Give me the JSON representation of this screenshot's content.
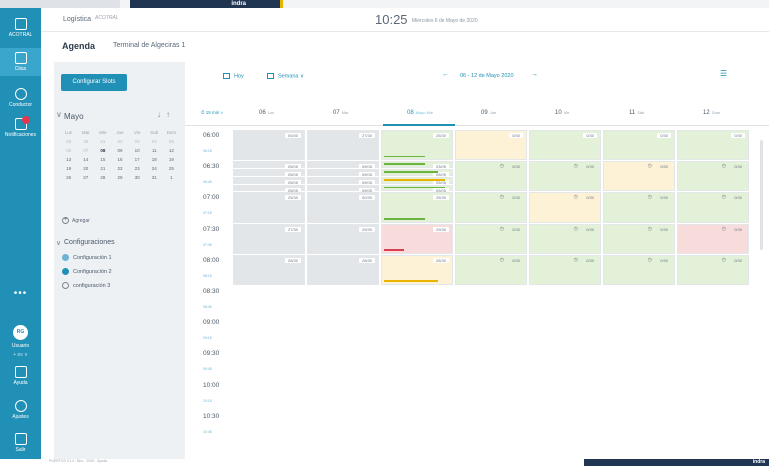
{
  "top_strip": {
    "brand": "indra"
  },
  "sidebar": {
    "items": [
      {
        "label": "ACOTRAL",
        "icon": "building-icon"
      },
      {
        "label": "Citas",
        "icon": "calendar-icon"
      },
      {
        "label": "Conductor",
        "icon": "driver-icon"
      },
      {
        "label": "Notificaciones",
        "icon": "bell-icon"
      }
    ],
    "more": "•••",
    "user": {
      "initials": "RG",
      "label": "Usuario",
      "sub": "+ es ∨"
    },
    "bottom": [
      {
        "label": "Ayuda",
        "icon": "help-icon"
      },
      {
        "label": "Ajustes",
        "icon": "gear-icon"
      },
      {
        "label": "Salir",
        "icon": "logout-icon"
      }
    ]
  },
  "header": {
    "app_name": "Logística",
    "logo_text": "ACOTRAL",
    "time": "10:25",
    "date": "Miércoles 6 de Mayo de 2020"
  },
  "page": {
    "title": "Agenda",
    "subtitle": "Terminal de Algeciras 1"
  },
  "left_panel": {
    "configure_button": "Configurar Slots",
    "month": "Mayo",
    "weekdays": [
      "Lun",
      "Mar",
      "Mie",
      "Jue",
      "Vie",
      "Sab",
      "Dom"
    ],
    "weeks": [
      [
        "29",
        "30",
        "01",
        "02",
        "03",
        "04",
        "05"
      ],
      [
        "06",
        "07",
        "08",
        "09",
        "10",
        "11",
        "12"
      ],
      [
        "13",
        "14",
        "15",
        "16",
        "17",
        "18",
        "19"
      ],
      [
        "19",
        "20",
        "21",
        "22",
        "23",
        "24",
        "25"
      ],
      [
        "26",
        "27",
        "28",
        "29",
        "30",
        "31",
        "1"
      ]
    ],
    "add_label": "Agregar",
    "configs_title": "Configuraciones",
    "configs": [
      "Configuración 1",
      "Configuración 2",
      "configuración 3"
    ]
  },
  "toolbar": {
    "today": "Hoy",
    "view": "Semana",
    "range": "06 - 12 de Mayo 2020",
    "prev": "←",
    "next": "→"
  },
  "interval": "15 min",
  "days": [
    {
      "num": "06",
      "name": "Lun"
    },
    {
      "num": "07",
      "name": "Mar"
    },
    {
      "num": "08",
      "name": "Mayo Mie"
    },
    {
      "num": "09",
      "name": "Jue"
    },
    {
      "num": "10",
      "name": "Vie"
    },
    {
      "num": "11",
      "name": "Sáb"
    },
    {
      "num": "12",
      "name": "Dom"
    }
  ],
  "times": [
    {
      "t": "06:00",
      "sub": "06:15"
    },
    {
      "t": "06:30",
      "sub": "06:45"
    },
    {
      "t": "07:00",
      "sub": "07:15"
    },
    {
      "t": "07:30",
      "sub": "07:45"
    },
    {
      "t": "08:00",
      "sub": "08:15"
    },
    {
      "t": "08:30",
      "sub": "08:45"
    },
    {
      "t": "09:00",
      "sub": "09:15"
    },
    {
      "t": "09:30",
      "sub": "09:45"
    },
    {
      "t": "10:00",
      "sub": "10:15"
    },
    {
      "t": "10:30",
      "sub": "10:45"
    }
  ],
  "colors": {
    "grey": "#e3e6e9",
    "green": "#e3f1d8",
    "yellow": "#fdf1d6",
    "red": "#f8dcdc",
    "green_bar": "#6db33f",
    "yellow_bar": "#e8b400",
    "red_bar": "#d9414f"
  },
  "slots": [
    {
      "day": 0,
      "row": 0,
      "span": 4,
      "color": "grey",
      "count": "00/30"
    },
    {
      "day": 1,
      "row": 0,
      "span": 4,
      "color": "grey",
      "count": "27/30"
    },
    {
      "day": 2,
      "row": 0,
      "span": 4,
      "color": "green",
      "count": "25/30",
      "bar": "green",
      "barw": 0.6
    },
    {
      "day": 3,
      "row": 0,
      "span": 4,
      "color": "yellow",
      "count": "0/30"
    },
    {
      "day": 4,
      "row": 0,
      "span": 4,
      "color": "green",
      "count": "0/30"
    },
    {
      "day": 5,
      "row": 0,
      "span": 4,
      "color": "green",
      "count": "0/30"
    },
    {
      "day": 6,
      "row": 0,
      "span": 4,
      "color": "green",
      "count": "0/30"
    },
    {
      "day": 0,
      "row": 4,
      "span": 1,
      "color": "grey",
      "count": "05/05"
    },
    {
      "day": 1,
      "row": 4,
      "span": 1,
      "color": "grey",
      "count": "05/05"
    },
    {
      "day": 2,
      "row": 4,
      "span": 1,
      "color": "green",
      "count": "03/05",
      "bar": "green",
      "barw": 0.6
    },
    {
      "day": 0,
      "row": 5,
      "span": 1,
      "color": "grey",
      "count": "05/05"
    },
    {
      "day": 1,
      "row": 5,
      "span": 1,
      "color": "grey",
      "count": "05/05"
    },
    {
      "day": 2,
      "row": 5,
      "span": 1,
      "color": "green",
      "count": "05/05",
      "bar": "green",
      "barw": 0.8
    },
    {
      "day": 0,
      "row": 6,
      "span": 1,
      "color": "grey",
      "count": "05/05"
    },
    {
      "day": 1,
      "row": 6,
      "span": 1,
      "color": "grey",
      "count": "05/05"
    },
    {
      "day": 2,
      "row": 6,
      "span": 1,
      "color": "green",
      "count": "05/05",
      "bar": "yellow",
      "barw": 0.9
    },
    {
      "day": 0,
      "row": 7,
      "span": 1,
      "color": "grey",
      "count": "05/05"
    },
    {
      "day": 1,
      "row": 7,
      "span": 1,
      "color": "grey",
      "count": "05/05"
    },
    {
      "day": 2,
      "row": 7,
      "span": 1,
      "color": "green",
      "count": "05/05",
      "bar": "green",
      "barw": 0.9
    },
    {
      "day": 3,
      "row": 4,
      "span": 4,
      "color": "green",
      "count": "0/30",
      "clock": true
    },
    {
      "day": 4,
      "row": 4,
      "span": 4,
      "color": "green",
      "count": "0/30",
      "clock": true
    },
    {
      "day": 5,
      "row": 4,
      "span": 4,
      "color": "yellow",
      "count": "0/30",
      "clock": true
    },
    {
      "day": 6,
      "row": 4,
      "span": 4,
      "color": "green",
      "count": "0/30",
      "clock": true
    },
    {
      "day": 0,
      "row": 8,
      "span": 4,
      "color": "grey",
      "count": "25/30"
    },
    {
      "day": 1,
      "row": 8,
      "span": 4,
      "color": "grey",
      "count": "00/30"
    },
    {
      "day": 2,
      "row": 8,
      "span": 4,
      "color": "green",
      "count": "25/30",
      "bar": "green",
      "barw": 0.6
    },
    {
      "day": 3,
      "row": 8,
      "span": 4,
      "color": "green",
      "count": "0/30",
      "clock": true
    },
    {
      "day": 4,
      "row": 8,
      "span": 4,
      "color": "yellow",
      "count": "0/30",
      "clock": true
    },
    {
      "day": 5,
      "row": 8,
      "span": 4,
      "color": "green",
      "count": "0/30",
      "clock": true
    },
    {
      "day": 6,
      "row": 8,
      "span": 4,
      "color": "green",
      "count": "0/30",
      "clock": true
    },
    {
      "day": 0,
      "row": 12,
      "span": 4,
      "color": "grey",
      "count": "27/30"
    },
    {
      "day": 1,
      "row": 12,
      "span": 4,
      "color": "grey",
      "count": "29/30"
    },
    {
      "day": 2,
      "row": 12,
      "span": 4,
      "color": "red",
      "count": "29/30",
      "bar": "red",
      "barw": 0.3
    },
    {
      "day": 3,
      "row": 12,
      "span": 4,
      "color": "green",
      "count": "0/30",
      "clock": true
    },
    {
      "day": 4,
      "row": 12,
      "span": 4,
      "color": "green",
      "count": "0/30",
      "clock": true
    },
    {
      "day": 5,
      "row": 12,
      "span": 4,
      "color": "green",
      "count": "0/30",
      "clock": true
    },
    {
      "day": 6,
      "row": 12,
      "span": 4,
      "color": "red",
      "count": "0/30",
      "clock": true
    },
    {
      "day": 0,
      "row": 16,
      "span": 4,
      "color": "grey",
      "count": "28/30"
    },
    {
      "day": 1,
      "row": 16,
      "span": 4,
      "color": "grey",
      "count": "28/30"
    },
    {
      "day": 2,
      "row": 16,
      "span": 4,
      "color": "yellow",
      "count": "28/30",
      "bar": "yellow",
      "barw": 0.8
    },
    {
      "day": 3,
      "row": 16,
      "span": 4,
      "color": "green",
      "count": "0/30",
      "clock": true
    },
    {
      "day": 4,
      "row": 16,
      "span": 4,
      "color": "green",
      "count": "0/30",
      "clock": true
    },
    {
      "day": 5,
      "row": 16,
      "span": 4,
      "color": "green",
      "count": "0/30",
      "clock": true
    },
    {
      "day": 6,
      "row": 16,
      "span": 4,
      "color": "green",
      "count": "0/30",
      "clock": true
    }
  ],
  "footer": {
    "version": "PUERTOS V1.4 · Bno · 2020 · Ayuda",
    "brand": "indra"
  }
}
